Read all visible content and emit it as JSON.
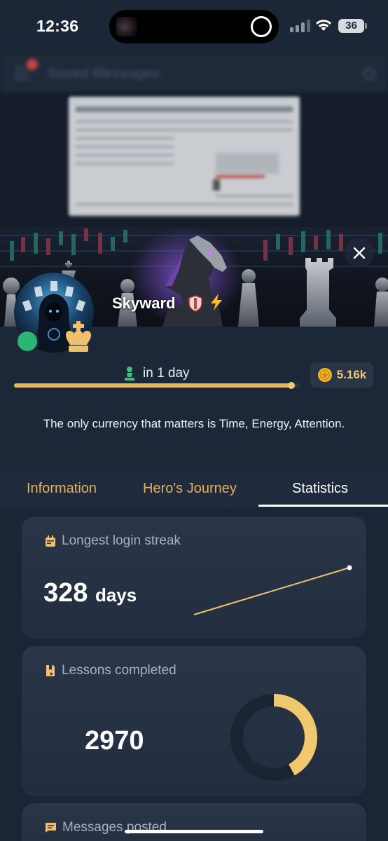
{
  "status_bar": {
    "time": "12:36",
    "battery": "36"
  },
  "background_chat": {
    "title": "Saved Messages"
  },
  "profile": {
    "username": "Skyward",
    "level_text": "in 1 day",
    "level_progress": 0.97,
    "coins": "5.16k",
    "bio": "The only currency that matters is Time, Energy, Attention."
  },
  "tabs": [
    {
      "label": "Information",
      "active": false
    },
    {
      "label": "Hero's Journey",
      "active": false
    },
    {
      "label": "Statistics",
      "active": true
    }
  ],
  "stats": {
    "login_streak": {
      "label": "Longest login streak",
      "value": "328",
      "unit": "days"
    },
    "lessons": {
      "label": "Lessons completed",
      "value": "2970",
      "ring_fraction": 0.42
    },
    "messages": {
      "label": "Messages posted"
    }
  },
  "colors": {
    "accent": "#e2b15f",
    "online": "#2bb673",
    "background": "#1c2838",
    "card": "#2a3648"
  }
}
